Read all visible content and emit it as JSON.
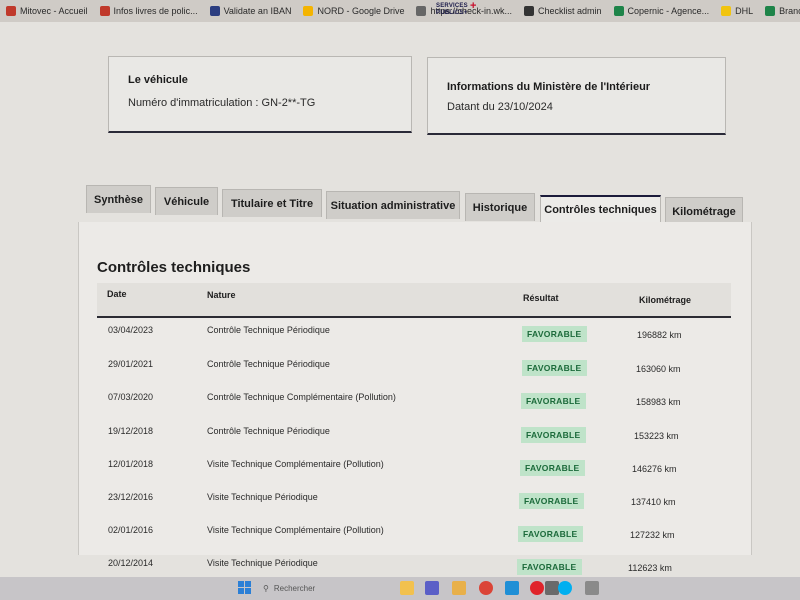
{
  "bookmarks": [
    {
      "label": "Mitovec - Accueil",
      "color": "#c0392b"
    },
    {
      "label": "Infos livres de polic...",
      "color": "#c0392b"
    },
    {
      "label": "Validate an IBAN",
      "color": "#2c3e80"
    },
    {
      "label": "NORD - Google Drive",
      "color": "#f4b400"
    },
    {
      "label": "https://check-in.wk...",
      "color": "#666666"
    },
    {
      "label": "Checklist admin",
      "color": "#333333"
    },
    {
      "label": "Copernic - Agence...",
      "color": "#1e8449"
    },
    {
      "label": "DHL",
      "color": "#f1c40f"
    },
    {
      "label": "Branch calendar - ...",
      "color": "#1e8449"
    }
  ],
  "brand": {
    "line1": "SERVICES",
    "line2": "PUBLICS+",
    "plus": "+"
  },
  "vehicle_card": {
    "title": "Le véhicule",
    "plate": "Numéro d'immatriculation : GN-2**-TG"
  },
  "info_card": {
    "title": "Informations du Ministère de l'Intérieur",
    "date": "Datant du 23/10/2024"
  },
  "tabs": [
    {
      "label": "Synthèse"
    },
    {
      "label": "Véhicule"
    },
    {
      "label": "Titulaire et Titre"
    },
    {
      "label": "Situation administrative"
    },
    {
      "label": "Historique"
    },
    {
      "label": "Contrôles techniques"
    },
    {
      "label": "Kilométrage"
    }
  ],
  "active_tab": "Contrôles techniques",
  "section": {
    "title": "Contrôles techniques"
  },
  "table": {
    "headers": {
      "date": "Date",
      "nature": "Nature",
      "result": "Résultat",
      "mileage": "Kilométrage"
    },
    "rows": [
      {
        "date": "03/04/2023",
        "nature": "Contrôle Technique Périodique",
        "result": "FAVORABLE",
        "km": "196882 km"
      },
      {
        "date": "29/01/2021",
        "nature": "Contrôle Technique Périodique",
        "result": "FAVORABLE",
        "km": "163060 km"
      },
      {
        "date": "07/03/2020",
        "nature": "Contrôle Technique Complémentaire (Pollution)",
        "result": "FAVORABLE",
        "km": "158983 km"
      },
      {
        "date": "19/12/2018",
        "nature": "Contrôle Technique Périodique",
        "result": "FAVORABLE",
        "km": "153223 km"
      },
      {
        "date": "12/01/2018",
        "nature": "Visite Technique Complémentaire (Pollution)",
        "result": "FAVORABLE",
        "km": "146276 km"
      },
      {
        "date": "23/12/2016",
        "nature": "Visite Technique Périodique",
        "result": "FAVORABLE",
        "km": "137410 km"
      },
      {
        "date": "02/01/2016",
        "nature": "Visite Technique Complémentaire (Pollution)",
        "result": "FAVORABLE",
        "km": "127232 km"
      },
      {
        "date": "20/12/2014",
        "nature": "Visite Technique Périodique",
        "result": "FAVORABLE",
        "km": "112623 km"
      }
    ]
  },
  "taskbar": {
    "search_placeholder": "Rechercher",
    "apps": [
      {
        "icon": "file-explorer-icon",
        "color": "#f2c14e"
      },
      {
        "icon": "teams-icon",
        "color": "#5b5fc7"
      },
      {
        "icon": "folder-icon",
        "color": "#e8b04a"
      },
      {
        "icon": "chrome-icon",
        "color": "#db4437"
      },
      {
        "icon": "edge-icon",
        "color": "#1f8fd6"
      },
      {
        "icon": "opera-icon",
        "color": "#e0242b"
      },
      {
        "icon": "mail-icon",
        "color": "#6a6a6a"
      },
      {
        "icon": "skype-icon",
        "color": "#00aff0"
      },
      {
        "icon": "app-icon",
        "color": "#8a8a8a"
      }
    ]
  }
}
